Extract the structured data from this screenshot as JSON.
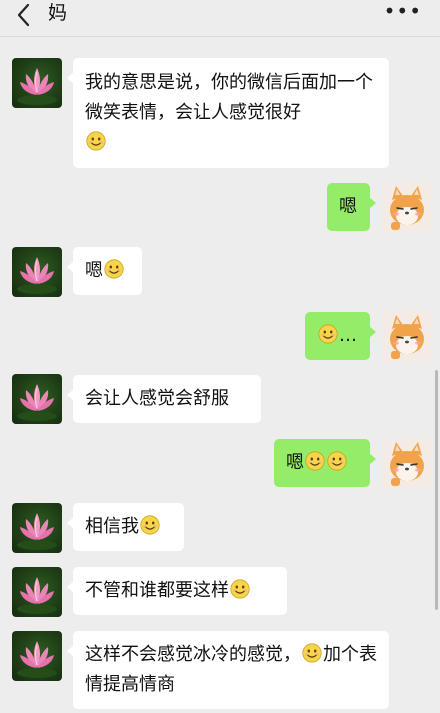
{
  "header": {
    "title": "妈",
    "back_icon": "chevron-left-icon",
    "more_label": "•••"
  },
  "emoji": {
    "name": "smile-emoji",
    "color": "#f7d54a"
  },
  "messages": [
    {
      "side": "left",
      "text": "我的意思是说，你的微信后面加一个微笑表情，会让人感觉很好",
      "emoji_count": 1
    },
    {
      "side": "right",
      "text": "嗯",
      "emoji_count": 0
    },
    {
      "side": "left",
      "text": "嗯",
      "emoji_count": 1
    },
    {
      "side": "right",
      "text": "…",
      "emoji_count": 1
    },
    {
      "side": "left",
      "text": "会让人感觉会舒服",
      "emoji_count": 0
    },
    {
      "side": "right",
      "text": "嗯",
      "emoji_count": 2
    },
    {
      "side": "left",
      "text": "相信我",
      "emoji_count": 1
    },
    {
      "side": "left",
      "text": "不管和谁都要这样",
      "emoji_count": 1
    },
    {
      "side": "left",
      "text_before": "这样不会感觉冰冷的感觉，",
      "text_after": "加个表情提高情商",
      "emoji_count": 1
    }
  ],
  "colors": {
    "background": "#ededed",
    "bubble_left": "#ffffff",
    "bubble_right": "#95ec69"
  }
}
